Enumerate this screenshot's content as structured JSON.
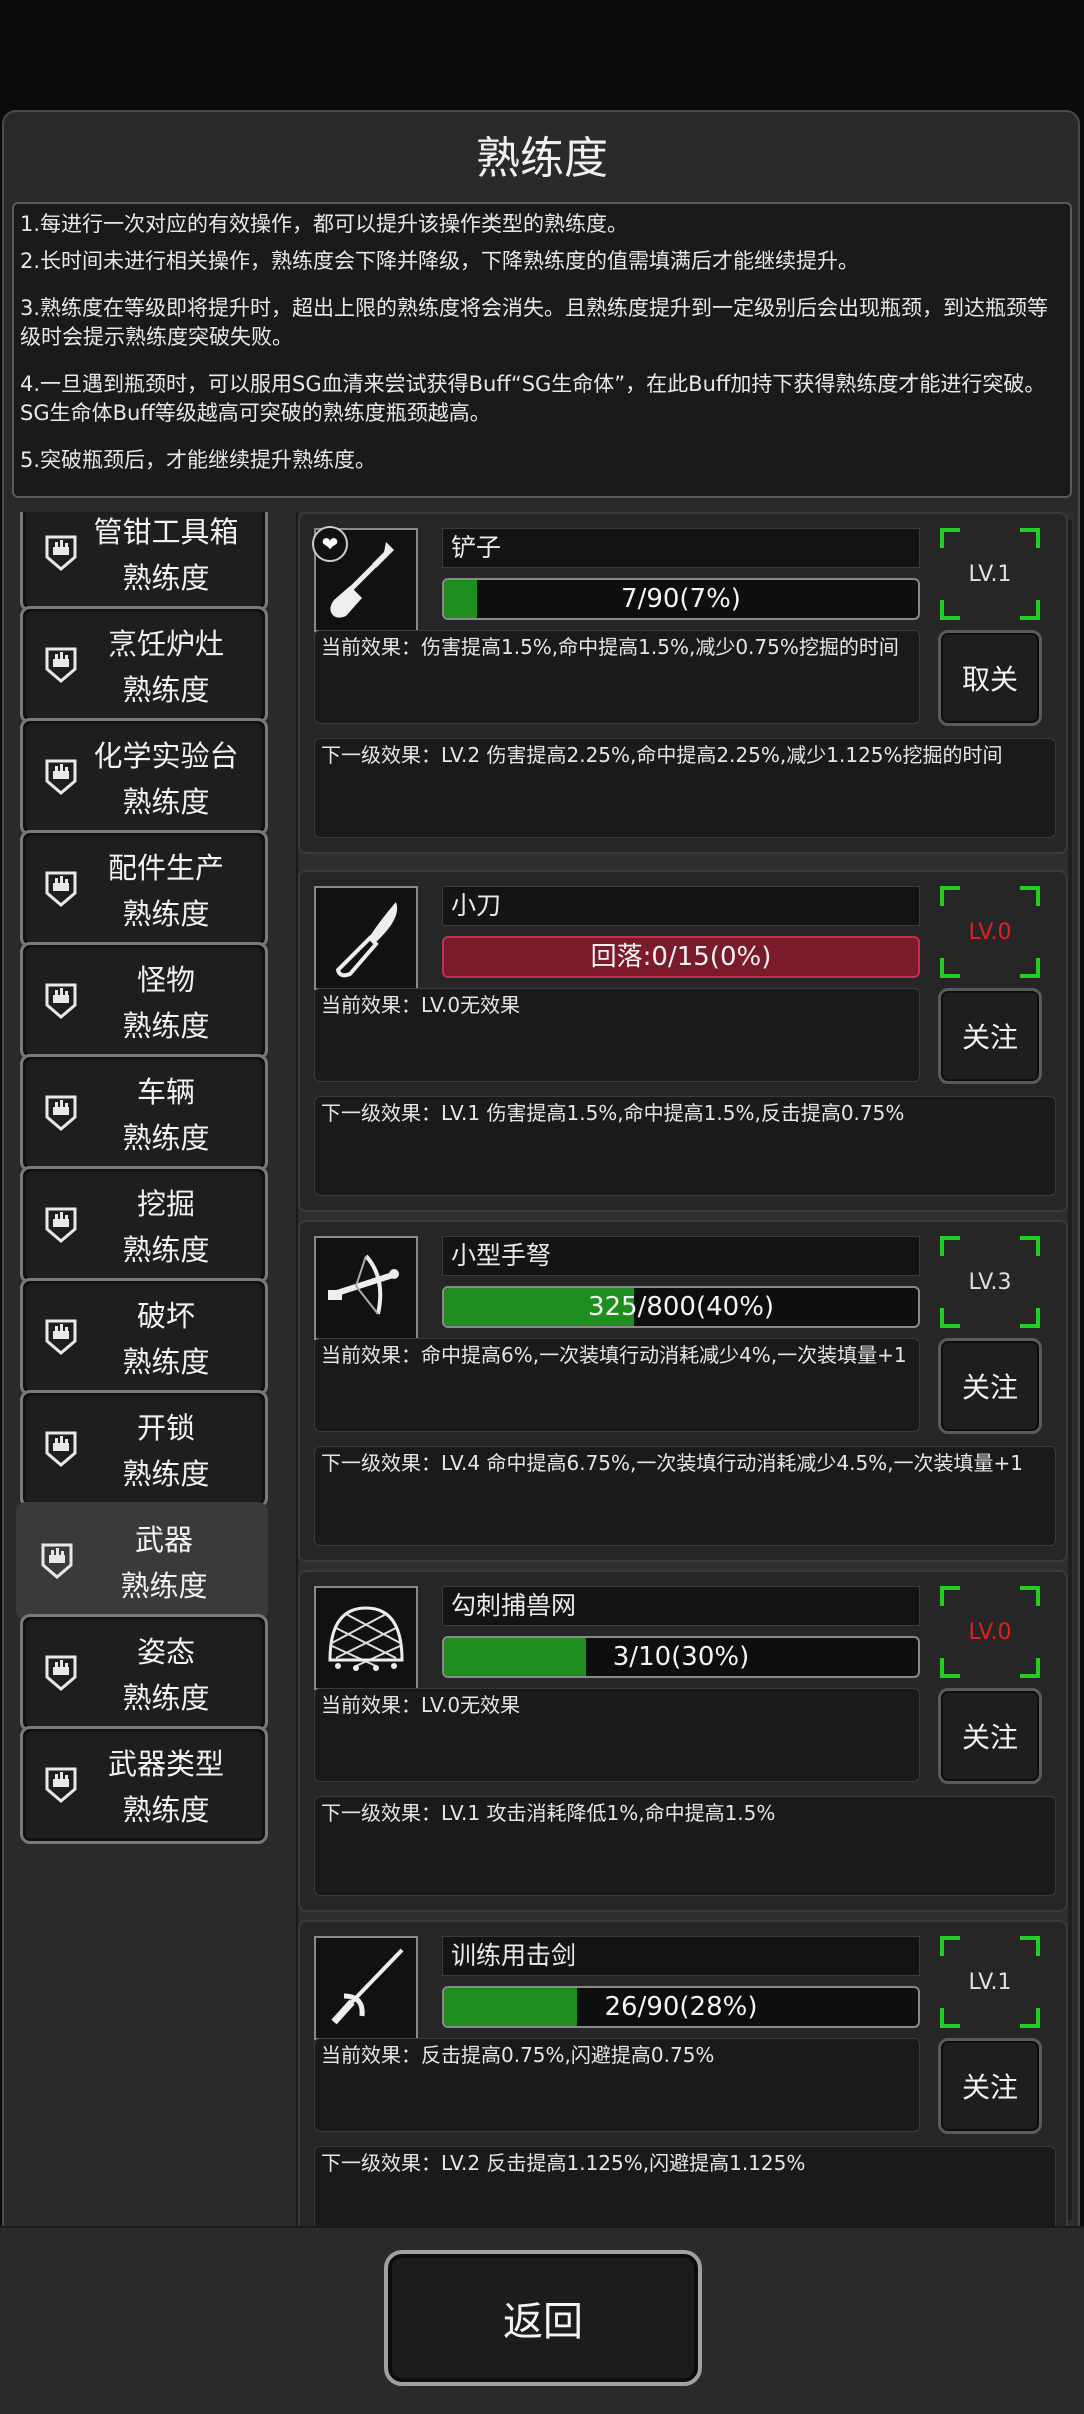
{
  "title": "熟练度",
  "rules": [
    "1.每进行一次对应的有效操作，都可以提升该操作类型的熟练度。",
    "2.长时间未进行相关操作，熟练度会下降并降级，下降熟练度的值需填满后才能继续提升。",
    "3.熟练度在等级即将提升时，超出上限的熟练度将会消失。且熟练度提升到一定级别后会出现瓶颈，到达瓶颈等级时会提示熟练度突破失败。",
    "4.一旦遇到瓶颈时，可以服用SG血清来尝试获得Buff“SG生命体”，在此Buff加持下获得熟练度才能进行突破。SG生命体Buff等级越高可突破的熟练度瓶颈越高。",
    "5.突破瓶颈后，才能继续提升熟练度。"
  ],
  "categories": [
    {
      "line1": "管钳工具箱",
      "line2": "熟练度"
    },
    {
      "line1": "烹饪炉灶",
      "line2": "熟练度"
    },
    {
      "line1": "化学实验台",
      "line2": "熟练度"
    },
    {
      "line1": "配件生产",
      "line2": "熟练度"
    },
    {
      "line1": "怪物",
      "line2": "熟练度"
    },
    {
      "line1": "车辆",
      "line2": "熟练度"
    },
    {
      "line1": "挖掘",
      "line2": "熟练度"
    },
    {
      "line1": "破坏",
      "line2": "熟练度"
    },
    {
      "line1": "开锁",
      "line2": "熟练度"
    },
    {
      "line1": "武器",
      "line2": "熟练度",
      "active": true
    },
    {
      "line1": "姿态",
      "line2": "熟练度"
    },
    {
      "line1": "武器类型",
      "line2": "熟练度"
    }
  ],
  "skills": [
    {
      "name": "铲子",
      "icon": "shovel-icon",
      "favorite": true,
      "progress_text": "7/90(7%)",
      "progress": 0.07,
      "regress": false,
      "level": "LV.1",
      "level_red": false,
      "current": "当前效果：伤害提高1.5%,命中提高1.5%,减少0.75%挖掘的时间",
      "button": "取关",
      "next": "下一级效果：LV.2 伤害提高2.25%,命中提高2.25%,减少1.125%挖掘的时间"
    },
    {
      "name": "小刀",
      "icon": "knife-icon",
      "favorite": false,
      "progress_text": "回落:0/15(0%)",
      "progress": 0.0,
      "regress": true,
      "level": "LV.0",
      "level_red": true,
      "current": "当前效果：LV.0无效果",
      "button": "关注",
      "next": "下一级效果：LV.1 伤害提高1.5%,命中提高1.5%,反击提高0.75%"
    },
    {
      "name": "小型手弩",
      "icon": "crossbow-icon",
      "favorite": false,
      "progress_text": "325/800(40%)",
      "progress": 0.4,
      "regress": false,
      "level": "LV.3",
      "level_red": false,
      "current": "当前效果：命中提高6%,一次装填行动消耗减少4%,一次装填量+1",
      "button": "关注",
      "next": "下一级效果：LV.4 命中提高6.75%,一次装填行动消耗减少4.5%,一次装填量+1"
    },
    {
      "name": "勾刺捕兽网",
      "icon": "net-icon",
      "favorite": false,
      "progress_text": "3/10(30%)",
      "progress": 0.3,
      "regress": false,
      "level": "LV.0",
      "level_red": true,
      "current": "当前效果：LV.0无效果",
      "button": "关注",
      "next": "下一级效果：LV.1 攻击消耗降低1%,命中提高1.5%"
    },
    {
      "name": "训练用击剑",
      "icon": "fencing-sword-icon",
      "favorite": false,
      "progress_text": "26/90(28%)",
      "progress": 0.28,
      "regress": false,
      "level": "LV.1",
      "level_red": false,
      "current": "当前效果：反击提高0.75%,闪避提高0.75%",
      "button": "关注",
      "next": "下一级效果：LV.2 反击提高1.125%,闪避提高1.125%"
    }
  ],
  "back_button": "返回",
  "colors": {
    "progress_green": "#1e8f1e",
    "regress_red": "#7a1a2a",
    "level_corner_green": "#20d020",
    "level_red": "#e02020"
  }
}
